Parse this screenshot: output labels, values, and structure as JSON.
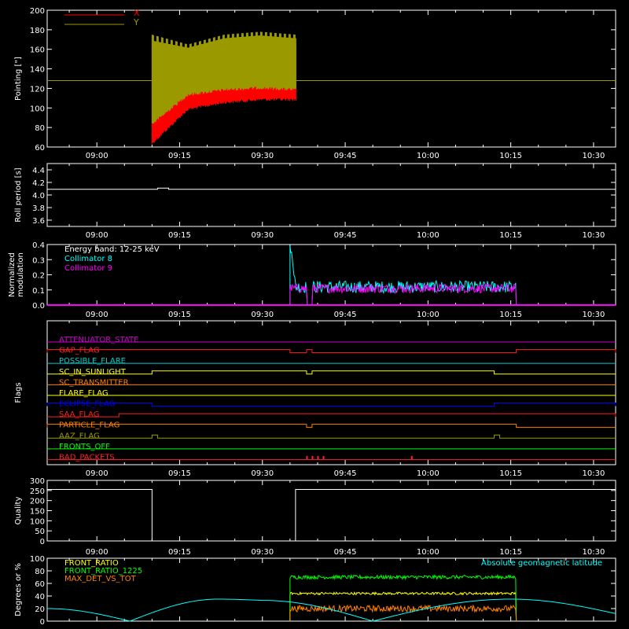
{
  "time_ticks": [
    "09:00",
    "09:15",
    "09:30",
    "09:45",
    "10:00",
    "10:15",
    "10:30"
  ],
  "panels": [
    {
      "id": "pointing",
      "ylabel": "Pointing [\"]",
      "yticks": [
        "60",
        "80",
        "100",
        "120",
        "140",
        "160",
        "180",
        "200"
      ],
      "legend": [
        {
          "label": "X",
          "color": "#ff0000"
        },
        {
          "label": "Y",
          "color": "#9a9a00"
        }
      ]
    },
    {
      "id": "roll",
      "ylabel": "Roll period [s]",
      "yticks": [
        "3.6",
        "3.8",
        "4.0",
        "4.2",
        "4.4"
      ]
    },
    {
      "id": "modulation",
      "ylabel": "Normalized modulation",
      "yticks": [
        "0.0",
        "0.1",
        "0.2",
        "0.3",
        "0.4"
      ],
      "legend": [
        {
          "label": "Energy band: 12-25 keV",
          "color": "#ffffff"
        },
        {
          "label": "Collimator 8",
          "color": "#00ffff"
        },
        {
          "label": "Collimator 9",
          "color": "#ff00ff"
        }
      ]
    },
    {
      "id": "flags",
      "ylabel": "Flags",
      "flag_names": [
        {
          "label": "ATTENUATOR_STATE",
          "color": "#cc00cc"
        },
        {
          "label": "GAP_FLAG",
          "color": "#ff2020"
        },
        {
          "label": "POSSIBLE_FLARE",
          "color": "#00cccc"
        },
        {
          "label": "SC_IN_SUNLIGHT",
          "color": "#ffff00"
        },
        {
          "label": "SC_TRANSMITTER",
          "color": "#ff8000"
        },
        {
          "label": "FLARE_FLAG",
          "color": "#ffff00"
        },
        {
          "label": "ECLIPSE_FLAG",
          "color": "#0000ff"
        },
        {
          "label": "SAA_FLAG",
          "color": "#ff2020"
        },
        {
          "label": "PARTICLE_FLAG",
          "color": "#ff8000"
        },
        {
          "label": "AAZ_FLAG",
          "color": "#9a9a00"
        },
        {
          "label": "FRONTS_OFF",
          "color": "#00ff00"
        },
        {
          "label": "BAD_PACKETS",
          "color": "#ff2020"
        }
      ]
    },
    {
      "id": "quality",
      "ylabel": "Quality",
      "yticks": [
        "0",
        "50",
        "100",
        "150",
        "200",
        "250",
        "300"
      ]
    },
    {
      "id": "ratios",
      "ylabel": "Degrees or %",
      "yticks": [
        "0",
        "20",
        "40",
        "60",
        "80",
        "100"
      ],
      "legend": [
        {
          "label": "FRONT_RATIO",
          "color": "#ffff00"
        },
        {
          "label": "FRONT_RATIO_1225",
          "color": "#00ff00"
        },
        {
          "label": "MAX_DET_VS_TOT",
          "color": "#ff8000"
        }
      ],
      "right_label": {
        "label": "Absolute geomagnetic latitude",
        "color": "#00ffff"
      }
    }
  ],
  "chart_data": [
    {
      "type": "line",
      "title": "",
      "xlabel": "",
      "ylabel": "Pointing [\"]",
      "x_range": [
        "08:51",
        "10:34"
      ],
      "ylim": [
        60,
        200
      ],
      "series": [
        {
          "name": "X",
          "color": "#ff0000",
          "start": "09:10",
          "end": "09:36",
          "envelope_low": [
            65,
            100,
            107,
            110,
            110
          ],
          "envelope_high": [
            170,
            160,
            165,
            170,
            168
          ],
          "outside_value": 128
        },
        {
          "name": "Y",
          "color": "#9a9a00",
          "start": "09:10",
          "end": "09:36",
          "envelope_low": [
            85,
            115,
            120,
            122,
            120
          ],
          "envelope_high": [
            175,
            165,
            175,
            178,
            175
          ],
          "outside_value": 128
        }
      ]
    },
    {
      "type": "line",
      "ylabel": "Roll period [s]",
      "ylim": [
        3.5,
        4.5
      ],
      "series": [
        {
          "name": "",
          "color": "#ffffff",
          "points": [
            [
              "08:51",
              4.09
            ],
            [
              "09:11",
              4.09
            ],
            [
              "09:11",
              4.11
            ],
            [
              "09:13",
              4.11
            ],
            [
              "09:13",
              4.09
            ],
            [
              "10:34",
              4.09
            ]
          ]
        }
      ]
    },
    {
      "type": "line",
      "ylabel": "Normalized modulation",
      "ylim": [
        0,
        0.4
      ],
      "series": [
        {
          "name": "Collimator 8",
          "color": "#00ffff",
          "start": "09:35",
          "end": "10:16",
          "typical": 0.12,
          "spread": 0.04,
          "peak": [
            [
              "09:35",
              0.38
            ],
            [
              "09:36",
              0.23
            ]
          ],
          "gap": [
            "09:38",
            "09:39"
          ]
        },
        {
          "name": "Collimator 9",
          "color": "#ff00ff",
          "start": "09:35",
          "end": "10:16",
          "typical": 0.11,
          "spread": 0.03,
          "gap": [
            "09:38",
            "09:39"
          ]
        }
      ]
    },
    {
      "type": "line",
      "ylabel": "Flags",
      "series": [
        {
          "name": "ATTENUATOR_STATE",
          "color": "#cc00cc",
          "on_intervals": []
        },
        {
          "name": "GAP_FLAG",
          "color": "#ff2020",
          "on_intervals": [
            [
              "08:51",
              "09:35"
            ],
            [
              "09:38",
              "09:39"
            ],
            [
              "10:16",
              "10:34"
            ]
          ]
        },
        {
          "name": "POSSIBLE_FLARE",
          "color": "#00cccc",
          "on_intervals": []
        },
        {
          "name": "SC_IN_SUNLIGHT",
          "color": "#ffff00",
          "on_intervals": [
            [
              "09:10",
              "09:38"
            ],
            [
              "09:39",
              "10:12"
            ]
          ]
        },
        {
          "name": "SC_TRANSMITTER",
          "color": "#ff8000",
          "on_intervals": []
        },
        {
          "name": "FLARE_FLAG",
          "color": "#ffff00",
          "on_intervals": []
        },
        {
          "name": "ECLIPSE_FLAG",
          "color": "#0000ff",
          "on_intervals": [
            [
              "08:51",
              "09:10"
            ],
            [
              "10:12",
              "10:34"
            ]
          ]
        },
        {
          "name": "SAA_FLAG",
          "color": "#ff2020",
          "on_intervals": [
            [
              "09:04",
              "10:34"
            ]
          ]
        },
        {
          "name": "PARTICLE_FLAG",
          "color": "#ff8000",
          "on_intervals": [
            [
              "08:51",
              "09:38"
            ],
            [
              "09:39",
              "10:16"
            ]
          ]
        },
        {
          "name": "AAZ_FLAG",
          "color": "#9a9a00",
          "on_intervals": [
            [
              "09:10",
              "09:11"
            ],
            [
              "10:12",
              "10:13"
            ]
          ]
        },
        {
          "name": "FRONTS_OFF",
          "color": "#00ff00",
          "on_intervals": []
        },
        {
          "name": "BAD_PACKETS",
          "color": "#ff2020",
          "on_intervals": [
            [
              "09:38",
              "09:38"
            ],
            [
              "09:39",
              "09:39"
            ],
            [
              "09:40",
              "09:40"
            ],
            [
              "09:41",
              "09:41"
            ],
            [
              "09:57",
              "09:57"
            ]
          ]
        }
      ]
    },
    {
      "type": "line",
      "ylabel": "Quality",
      "ylim": [
        0,
        300
      ],
      "series": [
        {
          "name": "",
          "color": "#ffffff",
          "points": [
            [
              "08:51",
              255
            ],
            [
              "09:10",
              255
            ],
            [
              "09:10",
              10
            ],
            [
              "09:10",
              0
            ],
            [
              "09:36",
              0
            ],
            [
              "09:36",
              255
            ],
            [
              "10:34",
              255
            ]
          ]
        }
      ]
    },
    {
      "type": "line",
      "ylabel": "Degrees or %",
      "ylim": [
        0,
        100
      ],
      "series": [
        {
          "name": "FRONT_RATIO",
          "color": "#ffff00",
          "start": "09:35",
          "end": "10:16",
          "typical": 44,
          "spread": 2
        },
        {
          "name": "FRONT_RATIO_1225",
          "color": "#00ff00",
          "start": "09:35",
          "end": "10:16",
          "typical": 70,
          "spread": 3
        },
        {
          "name": "MAX_DET_VS_TOT",
          "color": "#ff8000",
          "start": "09:35",
          "end": "10:16",
          "typical": 20,
          "spread": 5
        },
        {
          "name": "Absolute geomagnetic latitude",
          "color": "#00ffff",
          "points": [
            [
              "08:51",
              20
            ],
            [
              "09:06",
              0
            ],
            [
              "09:22",
              35
            ],
            [
              "09:30",
              33
            ],
            [
              "09:50",
              0
            ],
            [
              "10:15",
              35
            ],
            [
              "10:34",
              12
            ]
          ]
        }
      ]
    }
  ]
}
